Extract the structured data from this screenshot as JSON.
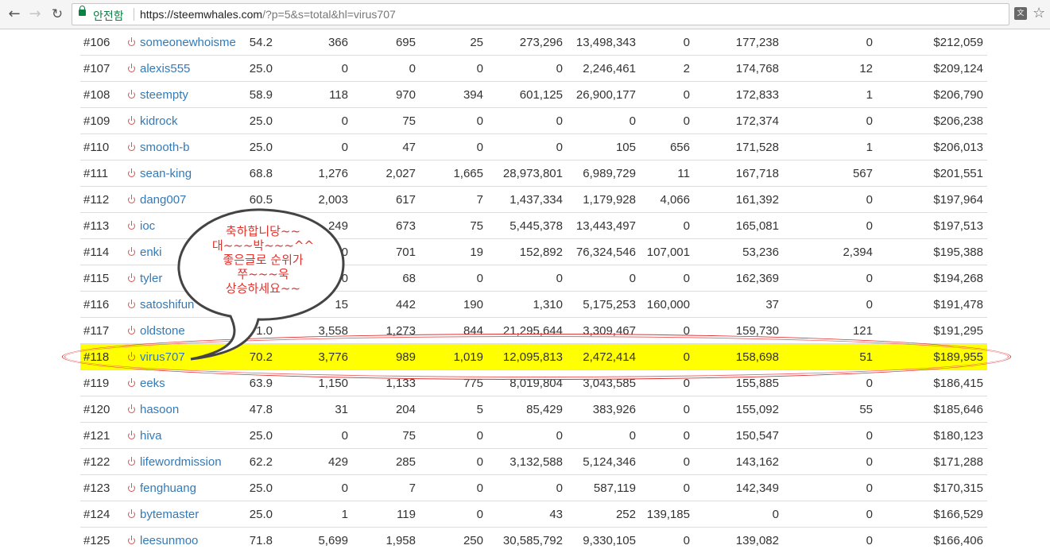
{
  "browser": {
    "secure_label": "안전함",
    "url_host": "https://steemwhales.com",
    "url_rest": "/?p=5&s=total&hl=virus707"
  },
  "rows": [
    {
      "rank": "#106",
      "user": "someonewhoisme",
      "c1": "54.2",
      "c2": "366",
      "c3": "695",
      "c4": "25",
      "c5": "273,296",
      "c6": "13,498,343",
      "c7": "0",
      "c8": "177,238",
      "c9": "0",
      "c10": "$212,059"
    },
    {
      "rank": "#107",
      "user": "alexis555",
      "c1": "25.0",
      "c2": "0",
      "c3": "0",
      "c4": "0",
      "c5": "0",
      "c6": "2,246,461",
      "c7": "2",
      "c8": "174,768",
      "c9": "12",
      "c10": "$209,124"
    },
    {
      "rank": "#108",
      "user": "steempty",
      "c1": "58.9",
      "c2": "118",
      "c3": "970",
      "c4": "394",
      "c5": "601,125",
      "c6": "26,900,177",
      "c7": "0",
      "c8": "172,833",
      "c9": "1",
      "c10": "$206,790"
    },
    {
      "rank": "#109",
      "user": "kidrock",
      "c1": "25.0",
      "c2": "0",
      "c3": "75",
      "c4": "0",
      "c5": "0",
      "c6": "0",
      "c7": "0",
      "c8": "172,374",
      "c9": "0",
      "c10": "$206,238"
    },
    {
      "rank": "#110",
      "user": "smooth-b",
      "c1": "25.0",
      "c2": "0",
      "c3": "47",
      "c4": "0",
      "c5": "0",
      "c6": "105",
      "c7": "656",
      "c8": "171,528",
      "c9": "1",
      "c10": "$206,013"
    },
    {
      "rank": "#111",
      "user": "sean-king",
      "c1": "68.8",
      "c2": "1,276",
      "c3": "2,027",
      "c4": "1,665",
      "c5": "28,973,801",
      "c6": "6,989,729",
      "c7": "11",
      "c8": "167,718",
      "c9": "567",
      "c10": "$201,551"
    },
    {
      "rank": "#112",
      "user": "dang007",
      "c1": "60.5",
      "c2": "2,003",
      "c3": "617",
      "c4": "7",
      "c5": "1,437,334",
      "c6": "1,179,928",
      "c7": "4,066",
      "c8": "161,392",
      "c9": "0",
      "c10": "$197,964"
    },
    {
      "rank": "#113",
      "user": "ioc",
      "c1": "",
      "c2": "249",
      "c3": "673",
      "c4": "75",
      "c5": "5,445,378",
      "c6": "13,443,497",
      "c7": "0",
      "c8": "165,081",
      "c9": "0",
      "c10": "$197,513"
    },
    {
      "rank": "#114",
      "user": "enki",
      "c1": "",
      "c2": "0",
      "c3": "701",
      "c4": "19",
      "c5": "152,892",
      "c6": "76,324,546",
      "c7": "107,001",
      "c8": "53,236",
      "c9": "2,394",
      "c10": "$195,388"
    },
    {
      "rank": "#115",
      "user": "tyler",
      "c1": "",
      "c2": "0",
      "c3": "68",
      "c4": "0",
      "c5": "0",
      "c6": "0",
      "c7": "0",
      "c8": "162,369",
      "c9": "0",
      "c10": "$194,268"
    },
    {
      "rank": "#116",
      "user": "satoshifun",
      "c1": "",
      "c2": "15",
      "c3": "442",
      "c4": "190",
      "c5": "1,310",
      "c6": "5,175,253",
      "c7": "160,000",
      "c8": "37",
      "c9": "0",
      "c10": "$191,478"
    },
    {
      "rank": "#117",
      "user": "oldstone",
      "c1": "71.0",
      "c2": "3,558",
      "c3": "1,273",
      "c4": "844",
      "c5": "21,295,644",
      "c6": "3,309,467",
      "c7": "0",
      "c8": "159,730",
      "c9": "121",
      "c10": "$191,295"
    },
    {
      "rank": "#118",
      "user": "virus707",
      "c1": "70.2",
      "c2": "3,776",
      "c3": "989",
      "c4": "1,019",
      "c5": "12,095,813",
      "c6": "2,472,414",
      "c7": "0",
      "c8": "158,698",
      "c9": "51",
      "c10": "$189,955"
    },
    {
      "rank": "#119",
      "user": "eeks",
      "c1": "63.9",
      "c2": "1,150",
      "c3": "1,133",
      "c4": "775",
      "c5": "8,019,804",
      "c6": "3,043,585",
      "c7": "0",
      "c8": "155,885",
      "c9": "0",
      "c10": "$186,415"
    },
    {
      "rank": "#120",
      "user": "hasoon",
      "c1": "47.8",
      "c2": "31",
      "c3": "204",
      "c4": "5",
      "c5": "85,429",
      "c6": "383,926",
      "c7": "0",
      "c8": "155,092",
      "c9": "55",
      "c10": "$185,646"
    },
    {
      "rank": "#121",
      "user": "hiva",
      "c1": "25.0",
      "c2": "0",
      "c3": "75",
      "c4": "0",
      "c5": "0",
      "c6": "0",
      "c7": "0",
      "c8": "150,547",
      "c9": "0",
      "c10": "$180,123"
    },
    {
      "rank": "#122",
      "user": "lifewordmission",
      "c1": "62.2",
      "c2": "429",
      "c3": "285",
      "c4": "0",
      "c5": "3,132,588",
      "c6": "5,124,346",
      "c7": "0",
      "c8": "143,162",
      "c9": "0",
      "c10": "$171,288"
    },
    {
      "rank": "#123",
      "user": "fenghuang",
      "c1": "25.0",
      "c2": "0",
      "c3": "7",
      "c4": "0",
      "c5": "0",
      "c6": "587,119",
      "c7": "0",
      "c8": "142,349",
      "c9": "0",
      "c10": "$170,315"
    },
    {
      "rank": "#124",
      "user": "bytemaster",
      "c1": "25.0",
      "c2": "1",
      "c3": "119",
      "c4": "0",
      "c5": "43",
      "c6": "252",
      "c7": "139,185",
      "c8": "0",
      "c9": "0",
      "c10": "$166,529"
    },
    {
      "rank": "#125",
      "user": "leesunmoo",
      "c1": "71.8",
      "c2": "5,699",
      "c3": "1,958",
      "c4": "250",
      "c5": "30,585,792",
      "c6": "9,330,105",
      "c7": "0",
      "c8": "139,082",
      "c9": "0",
      "c10": "$166,406"
    }
  ],
  "highlight_rank": "#118",
  "colors": {
    "highlight": "#ffff00",
    "link": "#337ab7",
    "power": "#d9534f",
    "annotation": "#e0312b"
  },
  "annotation": {
    "lines": [
      "축하합니당~~",
      "대~~~박~~~^^",
      "좋은글로 순위가",
      "쭈~~~욱",
      "상승하세요~~"
    ]
  }
}
